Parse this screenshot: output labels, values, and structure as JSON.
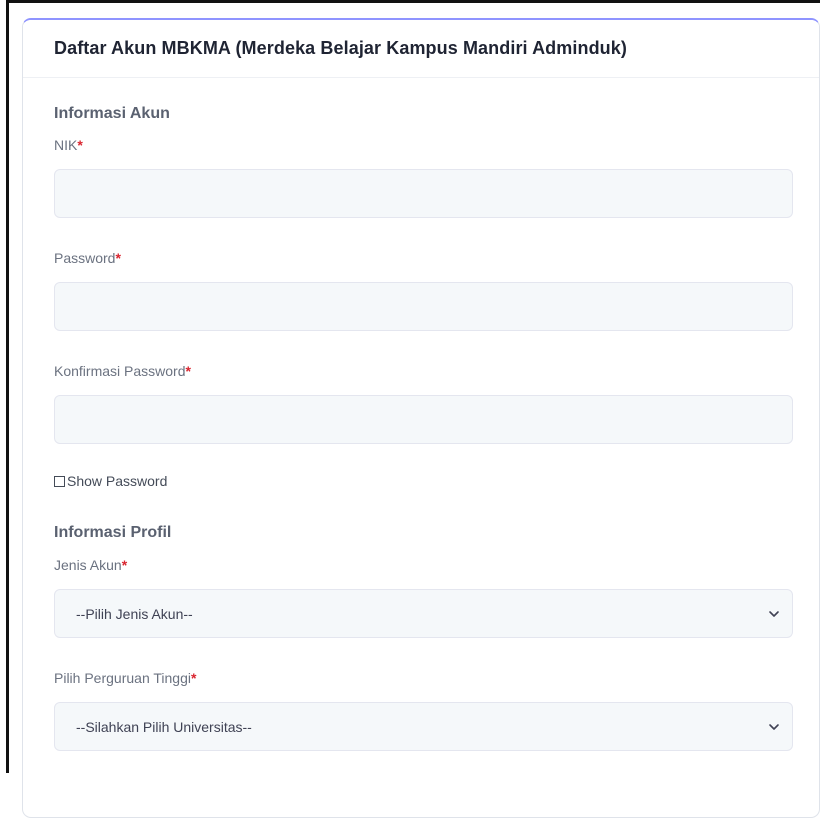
{
  "card": {
    "title": "Daftar Akun MBKMA (Merdeka Belajar Kampus Mandiri Adminduk)"
  },
  "account_section": {
    "title": "Informasi Akun",
    "nik": {
      "label": "NIK",
      "required_mark": "*",
      "value": ""
    },
    "password": {
      "label": "Password",
      "required_mark": "*",
      "value": ""
    },
    "confirm_password": {
      "label": "Konfirmasi Password",
      "required_mark": "*",
      "value": ""
    },
    "show_password": {
      "label": "Show Password",
      "checked": false
    }
  },
  "profile_section": {
    "title": "Informasi Profil",
    "account_type": {
      "label": "Jenis Akun",
      "required_mark": "*",
      "selected": "--Pilih Jenis Akun--"
    },
    "university": {
      "label": "Pilih Perguruan Tinggi",
      "required_mark": "*",
      "selected": "--Silahkan Pilih Universitas--"
    }
  },
  "colors": {
    "accent_top_border": "#8f94ff",
    "required": "#d9252f",
    "input_bg": "#f5f8fa"
  }
}
